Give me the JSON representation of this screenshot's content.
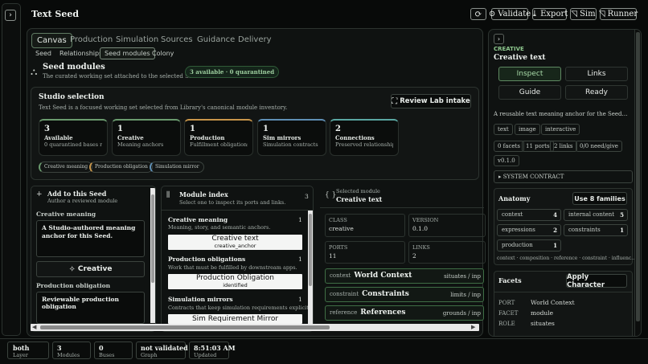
{
  "app": {
    "title": "Text Seed",
    "collapse_glyph": "›"
  },
  "toolbar": {
    "refresh_glyph": "⟳",
    "validate_label": "Validate",
    "export_label": "Export",
    "sim_label": "Sim",
    "runner_label": "Runner"
  },
  "tabs": [
    "Canvas",
    "Production",
    "Simulation",
    "Sources",
    "Guidance",
    "Delivery"
  ],
  "subtabs": [
    "Seed",
    "Relationships",
    "Seed modules",
    "Colony"
  ],
  "seed_modules": {
    "title": "Seed modules",
    "subtitle": "The curated working set attached to the selected Seed.",
    "badge": "3 available · 0 quarantined"
  },
  "studio": {
    "title": "Studio selection",
    "desc": "Text Seed is a focused working set selected from Library's canonical module inventory.",
    "review_button": "Review Lab intake",
    "cards": [
      {
        "count": "3",
        "title": "Available",
        "desc": "0 quarantined bases reta…"
      },
      {
        "count": "1",
        "title": "Creative",
        "desc": "Meaning anchors"
      },
      {
        "count": "1",
        "title": "Production",
        "desc": "Fulfillment obligations"
      },
      {
        "count": "1",
        "title": "Sim mirrors",
        "desc": "Simulation contracts"
      },
      {
        "count": "2",
        "title": "Connections",
        "desc": "Preserved relationships"
      }
    ],
    "chips": [
      "Creative meaning",
      "Production obligation",
      "Simulation mirror"
    ]
  },
  "add_panel": {
    "title": "Add to this Seed",
    "subtitle": "Author a reviewed module",
    "section1": "Creative meaning",
    "box1": "A Studio-authored meaning anchor for this Seed.",
    "creative_button": "Creative",
    "section2": "Production obligation",
    "box2": "Reviewable production obligation"
  },
  "module_index": {
    "title": "Module index",
    "subtitle": "Select one to inspect its ports and links.",
    "count": "3",
    "groups": [
      {
        "name": "Creative meaning",
        "count": "1",
        "desc": "Meaning, story, and semantic anchors.",
        "item": "Creative text",
        "item_id": "creative_anchor"
      },
      {
        "name": "Production obligations",
        "count": "1",
        "desc": "Work that must be fulfilled by downstream apps.",
        "item": "Production Obligation",
        "item_id": "identified"
      },
      {
        "name": "Simulation mirrors",
        "count": "1",
        "desc": "Contracts that keep simulation requirements explicit.",
        "item": "Sim Requirement Mirror",
        "item_id": ""
      }
    ]
  },
  "selected_module": {
    "label": "Selected module",
    "name": "Creative text",
    "class_label": "CLASS",
    "class_value": "creative",
    "version_label": "VERSION",
    "version_value": "0.1.0",
    "ports_label": "PORTS",
    "ports_value": "11",
    "links_label": "LINKS",
    "links_value": "2",
    "rows": [
      {
        "kind": "context",
        "name": "World Context",
        "right": "situates / inp"
      },
      {
        "kind": "constraint",
        "name": "Constraints",
        "right": "limits / inp"
      },
      {
        "kind": "reference",
        "name": "References",
        "right": "grounds / inp"
      }
    ]
  },
  "inspector": {
    "kicker": "CREATIVE",
    "title": "Creative text",
    "buttons": [
      "Inspect",
      "Links",
      "Guide",
      "Ready"
    ],
    "description": "A reusable text meaning anchor for the Seed…",
    "tags": [
      "text",
      "image",
      "interactive"
    ],
    "stats": [
      "0 facets",
      "11 ports",
      "2 links",
      "0/0 need/give"
    ],
    "version": "v0.1.0",
    "system_contract": "SYSTEM CONTRACT",
    "anatomy_title": "Anatomy",
    "anatomy_button": "Use 8 families",
    "anatomy": [
      {
        "name": "context",
        "count": "4"
      },
      {
        "name": "internal content",
        "count": "5"
      },
      {
        "name": "expressions",
        "count": "2"
      },
      {
        "name": "constraints",
        "count": "1"
      },
      {
        "name": "production",
        "count": "1"
      }
    ],
    "anatomy_footer": "context · composition · reference · constraint · influenc…",
    "facets_title": "Facets",
    "facets_button": "Apply Character",
    "facet_rows": [
      {
        "key": "PORT",
        "value": "World Context"
      },
      {
        "key": "FACET",
        "value": "module"
      },
      {
        "key": "ROLE",
        "value": "situates"
      }
    ]
  },
  "statusbar": [
    {
      "value": "both",
      "label": "Layer"
    },
    {
      "value": "3",
      "label": "Modules"
    },
    {
      "value": "0",
      "label": "Buses"
    },
    {
      "value": "not validated",
      "label": "Graph"
    },
    {
      "value": "8:51:03 AM",
      "label": "Updated"
    }
  ],
  "colors": {
    "accent_green": "#6a9a6e",
    "accent_orange": "#c8954a",
    "accent_blue": "#5f8fb5",
    "accent_teal": "#5aa7a2"
  }
}
